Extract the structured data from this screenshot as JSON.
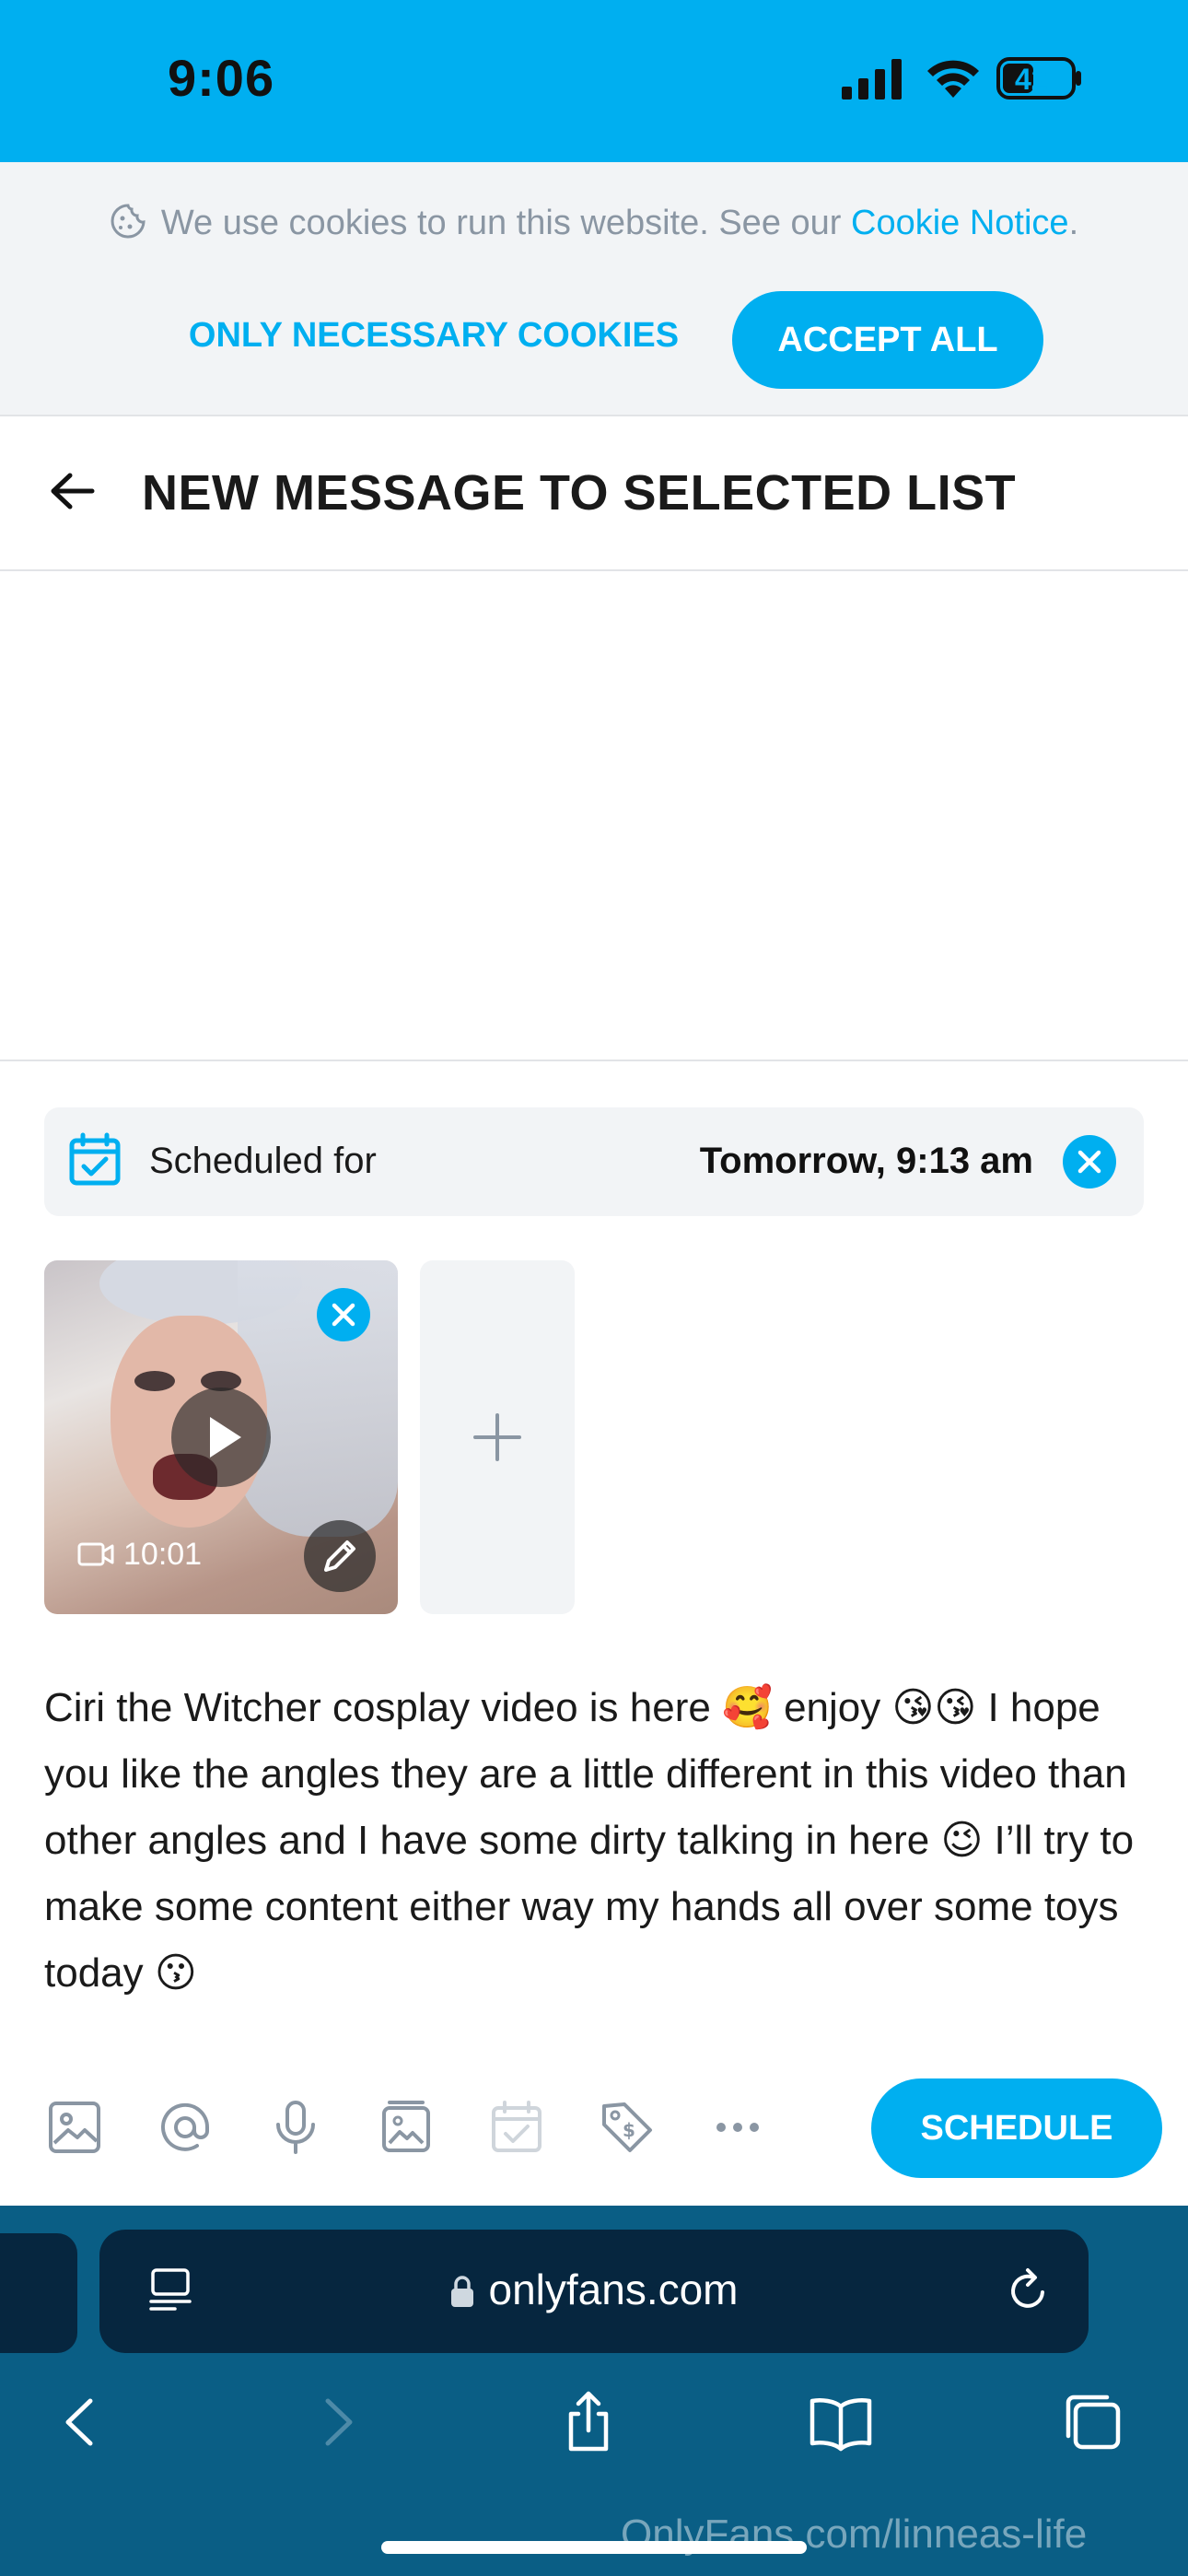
{
  "status_bar": {
    "time": "9:06",
    "battery": "42",
    "icons": [
      "signal-icon",
      "wifi-icon",
      "battery-icon"
    ]
  },
  "cookie_banner": {
    "text": "We use cookies to run this website. See our ",
    "link": "Cookie Notice",
    "period": ".",
    "necessary_label": "ONLY NECESSARY COOKIES",
    "accept_label": "ACCEPT ALL"
  },
  "header": {
    "title": "NEW MESSAGE TO SELECTED LIST"
  },
  "schedule": {
    "label": "Scheduled for",
    "value": "Tomorrow, 9:13 am"
  },
  "media": {
    "duration": "10:01"
  },
  "message": {
    "text": "Ciri the Witcher cosplay video is here 🥰 enjoy 😘😘 I hope you like the angles they are a little different in this video than other angles and I have some dirty talking in here 😉 I’ll try to make some content either way my hands all over some toys today 😗"
  },
  "toolbar": {
    "icons": [
      "image-icon",
      "mention-icon",
      "microphone-icon",
      "vault-icon",
      "calendar-icon",
      "price-tag-icon",
      "more-icon"
    ],
    "schedule_label": "SCHEDULE"
  },
  "browser": {
    "url": "onlyfans.com",
    "watermark": "OnlyFans.com/linneas-life"
  },
  "colors": {
    "accent": "#00aff0",
    "banner_bg": "#f2f4f6",
    "browser_bg": "#0a5e85"
  }
}
